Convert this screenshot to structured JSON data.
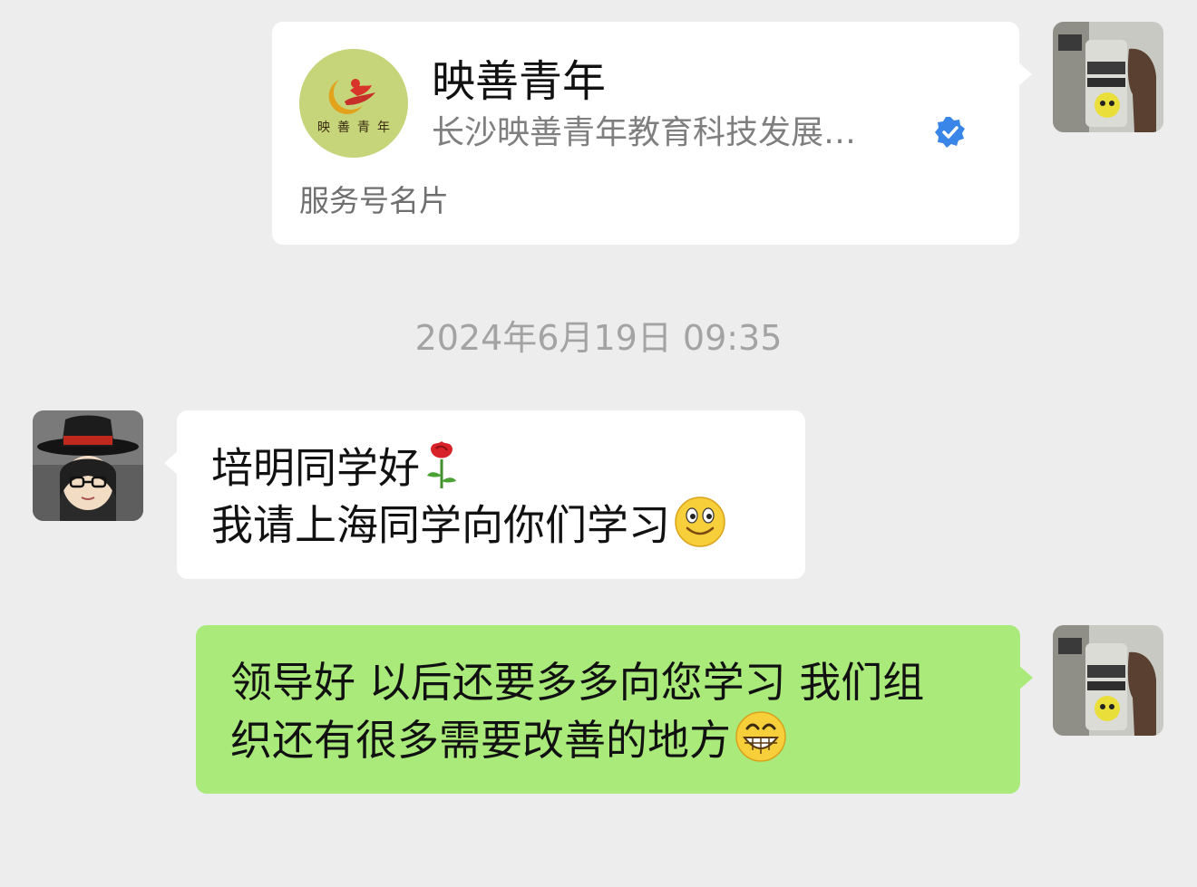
{
  "card": {
    "logo_text": "映善青年",
    "title": "映善青年",
    "subtitle": "长沙映善青年教育科技发展…",
    "verified_icon": "verified-badge-icon",
    "footer": "服务号名片"
  },
  "timestamp": "2024年6月19日 09:35",
  "received": {
    "line1": "培明同学好",
    "line1_emoji": "rose-emoji",
    "line2": "我请上海同学向你们学习",
    "line2_emoji": "smile-emoji"
  },
  "sent": {
    "line1": "领导好 以后还要多多向您学习 我们组",
    "line2": "织还有很多需要改善的地方",
    "line2_emoji": "grin-emoji"
  },
  "colors": {
    "background": "#ededed",
    "sent_bubble": "#a9ea7a",
    "received_bubble": "#ffffff",
    "verified_blue": "#3a86e8"
  }
}
